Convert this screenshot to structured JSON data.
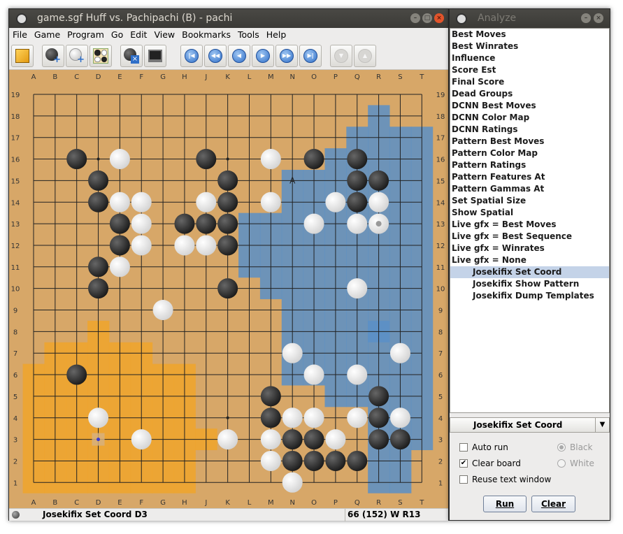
{
  "main_window": {
    "title": "game.sgf  Huff vs. Pachipachi (B) - pachi",
    "menus": [
      "File",
      "Game",
      "Program",
      "Go",
      "Edit",
      "View",
      "Bookmarks",
      "Tools",
      "Help"
    ],
    "toolbar_icons": [
      "new-game-icon",
      "add-black-stone-icon",
      "add-white-stone-icon",
      "setup-position-icon",
      "detach-program-icon",
      "gtp-shell-icon",
      "go-beginning-icon",
      "back-ten-icon",
      "back-icon",
      "forward-icon",
      "forward-ten-icon",
      "go-end-icon",
      "previous-variation-icon",
      "next-variation-icon"
    ],
    "nav_glyphs": [
      "|◀",
      "◀◀",
      "◀",
      "▶",
      "▶▶",
      "▶|",
      "▼",
      "▲"
    ],
    "status_left": "Josekifix Set Coord D3",
    "status_right": "66 (152) W R13"
  },
  "board": {
    "size": 19,
    "columns": [
      "A",
      "B",
      "C",
      "D",
      "E",
      "F",
      "G",
      "H",
      "J",
      "K",
      "L",
      "M",
      "N",
      "O",
      "P",
      "Q",
      "R",
      "S",
      "T"
    ],
    "rows": [
      "19",
      "18",
      "17",
      "16",
      "15",
      "14",
      "13",
      "12",
      "11",
      "10",
      "9",
      "8",
      "7",
      "6",
      "5",
      "4",
      "3",
      "2",
      "1"
    ],
    "black_stones": [
      "C16",
      "J16",
      "D15",
      "K15",
      "O16",
      "Q16",
      "Q15",
      "R15",
      "D14",
      "K14",
      "Q14",
      "E13",
      "H13",
      "J13",
      "K13",
      "E12",
      "K12",
      "D11",
      "D10",
      "K10",
      "C6",
      "M5",
      "R5",
      "M4",
      "R4",
      "N3",
      "O3",
      "R3",
      "S3",
      "N2",
      "O2",
      "P2",
      "Q2"
    ],
    "white_stones": [
      "E16",
      "M16",
      "E14",
      "F14",
      "J14",
      "M14",
      "P14",
      "R14",
      "F13",
      "O13",
      "Q13",
      "R13",
      "F12",
      "H12",
      "J12",
      "E11",
      "Q10",
      "G9",
      "N7",
      "S7",
      "O6",
      "Q6",
      "D4",
      "N4",
      "O4",
      "Q4",
      "S4",
      "F3",
      "K3",
      "M3",
      "P3",
      "M2",
      "N1"
    ],
    "last_move": "R13",
    "marker_label": "A",
    "marker_point": "N15",
    "marked_point": "D3",
    "hoshi": [
      "D16",
      "K16",
      "Q16",
      "D10",
      "K10",
      "Q10",
      "D4",
      "K4",
      "Q4"
    ],
    "colors": {
      "board": "#d7a768",
      "blue_region": "#5b8fc7",
      "orange_region": "#f0a52b",
      "black": "#2a2a2a",
      "white": "#f2f2f2"
    }
  },
  "analyze_window": {
    "title": "Analyze",
    "commands": [
      {
        "label": "Best Moves",
        "sub": false
      },
      {
        "label": "Best Winrates",
        "sub": false
      },
      {
        "label": "Influence",
        "sub": false
      },
      {
        "label": "Score Est",
        "sub": false
      },
      {
        "label": "Final Score",
        "sub": false
      },
      {
        "label": "Dead Groups",
        "sub": false
      },
      {
        "label": "DCNN Best Moves",
        "sub": false
      },
      {
        "label": "DCNN Color Map",
        "sub": false
      },
      {
        "label": "DCNN Ratings",
        "sub": false
      },
      {
        "label": "Pattern Best Moves",
        "sub": false
      },
      {
        "label": "Pattern Color Map",
        "sub": false
      },
      {
        "label": "Pattern Ratings",
        "sub": false
      },
      {
        "label": "Pattern Features At",
        "sub": false
      },
      {
        "label": "Pattern Gammas At",
        "sub": false
      },
      {
        "label": "Set Spatial Size",
        "sub": false
      },
      {
        "label": "Show Spatial",
        "sub": false
      },
      {
        "label": "Live gfx = Best Moves",
        "sub": false
      },
      {
        "label": "Live gfx = Best Sequence",
        "sub": false
      },
      {
        "label": "Live gfx = Winrates",
        "sub": false
      },
      {
        "label": "Live gfx = None",
        "sub": false
      },
      {
        "label": "Josekifix Set Coord",
        "sub": true,
        "selected": true
      },
      {
        "label": "Josekifix Show Pattern",
        "sub": true
      },
      {
        "label": "Josekifix Dump Templates",
        "sub": true
      }
    ],
    "combo_value": "Josekifix Set Coord",
    "options": {
      "auto_run": {
        "label": "Auto run",
        "checked": false
      },
      "clear_board": {
        "label": "Clear board",
        "checked": true
      },
      "reuse_text_window": {
        "label": "Reuse text window",
        "checked": false
      },
      "black": {
        "label": "Black",
        "selected": true,
        "disabled": true
      },
      "white": {
        "label": "White",
        "selected": false,
        "disabled": true
      }
    },
    "buttons": {
      "run": "Run",
      "clear": "Clear"
    }
  }
}
